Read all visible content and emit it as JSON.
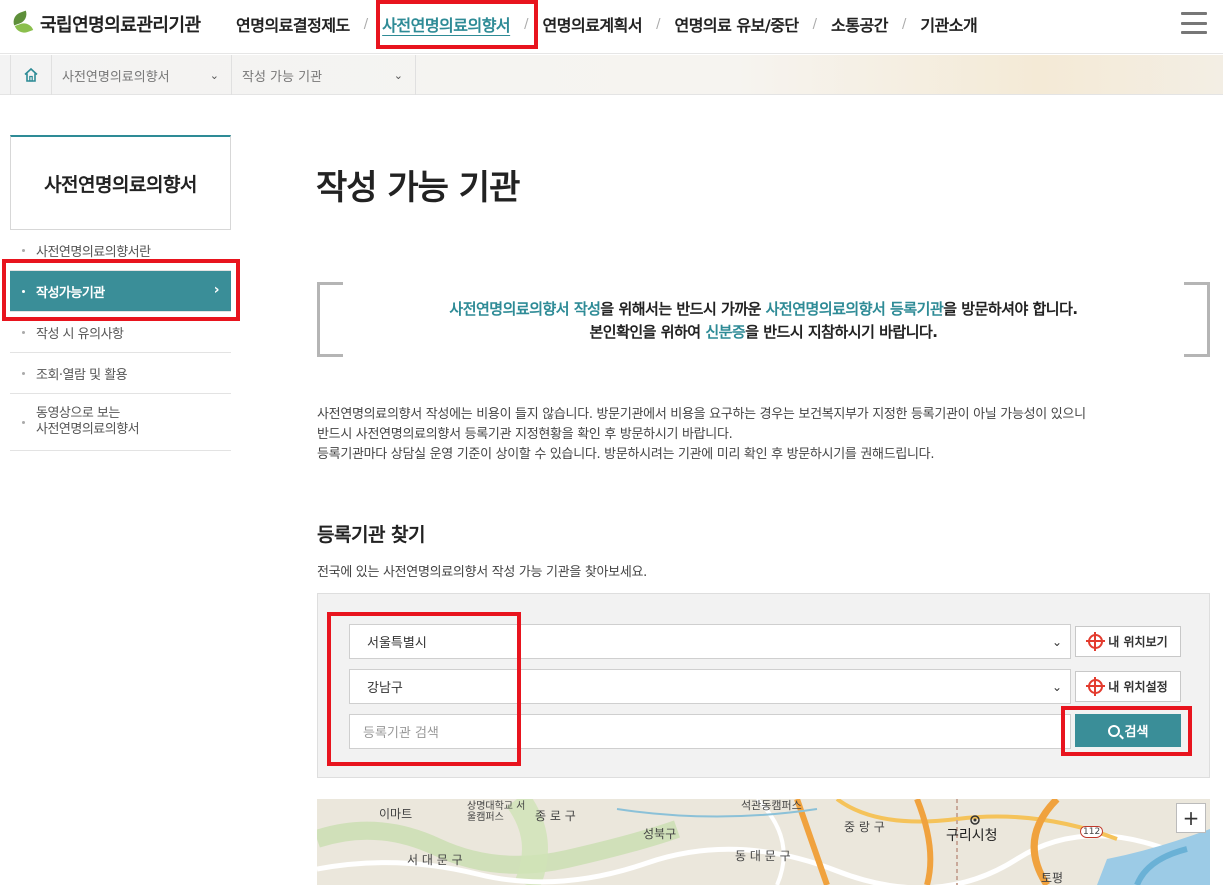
{
  "header": {
    "logo_text": "국립연명의료관리기관",
    "nav": [
      {
        "label": "연명의료결정제도"
      },
      {
        "label": "사전연명의료의향서"
      },
      {
        "label": "연명의료계획서"
      },
      {
        "label": "연명의료 유보/중단"
      },
      {
        "label": "소통공간"
      },
      {
        "label": "기관소개"
      }
    ],
    "nav_sep": "/"
  },
  "breadcrumb": {
    "level1": "사전연명의료의향서",
    "level2": "작성 가능 기관"
  },
  "sidebar": {
    "title": "사전연명의료의향서",
    "items": [
      {
        "label": "사전연명의료의향서란"
      },
      {
        "label": "작성가능기관",
        "arrow": "›"
      },
      {
        "label": "작성 시 유의사항"
      },
      {
        "label": "조회·열람 및 활용"
      },
      {
        "label_line1": "동영상으로 보는",
        "label_line2": "사전연명의료의향서"
      }
    ]
  },
  "main": {
    "title": "작성 가능 기관",
    "notice": {
      "l1_a": "사전연명의료의향서 작성",
      "l1_b": "을 위해서는 반드시 가까운 ",
      "l1_c": "사전연명의료의향서 등록기관",
      "l1_d": "을 방문하셔야 합니다.",
      "l2_a": "본인확인을 위하여 ",
      "l2_b": "신분증",
      "l2_c": "을 반드시 지참하시기 바랍니다."
    },
    "desc": [
      "사전연명의료의향서 작성에는 비용이 들지 않습니다. 방문기관에서 비용을 요구하는 경우는 보건복지부가 지정한 등록기관이 아닐 가능성이 있으니",
      "반드시 사전연명의료의향서 등록기관 지정현황을 확인 후 방문하시기 바랍니다.",
      "등록기관마다 상담실 운영 기준이 상이할 수 있습니다. 방문하시려는 기관에 미리 확인 후 방문하시기를 권해드립니다."
    ],
    "section_title": "등록기관 찾기",
    "section_desc": "전국에 있는 사전연명의료의향서 작성 가능 기관을 찾아보세요.",
    "search": {
      "sido": "서울특별시",
      "sigungu": "강남구",
      "keyword_placeholder": "등록기관 검색",
      "my_location_view": "내 위치보기",
      "my_location_set": "내 위치설정",
      "search_button": "검색"
    },
    "map": {
      "labels": [
        "이마트",
        "상명대학교 서울캠퍼스",
        "종 로 구",
        "석관동캠퍼스",
        "성북구",
        "중 랑 구",
        "구리시청",
        "서 대 문 구",
        "동 대 문 구",
        "토평",
        "112"
      ],
      "zoom_in": "+"
    }
  },
  "colors": {
    "accent": "#2e8b96",
    "highlight": "#e8141e"
  }
}
